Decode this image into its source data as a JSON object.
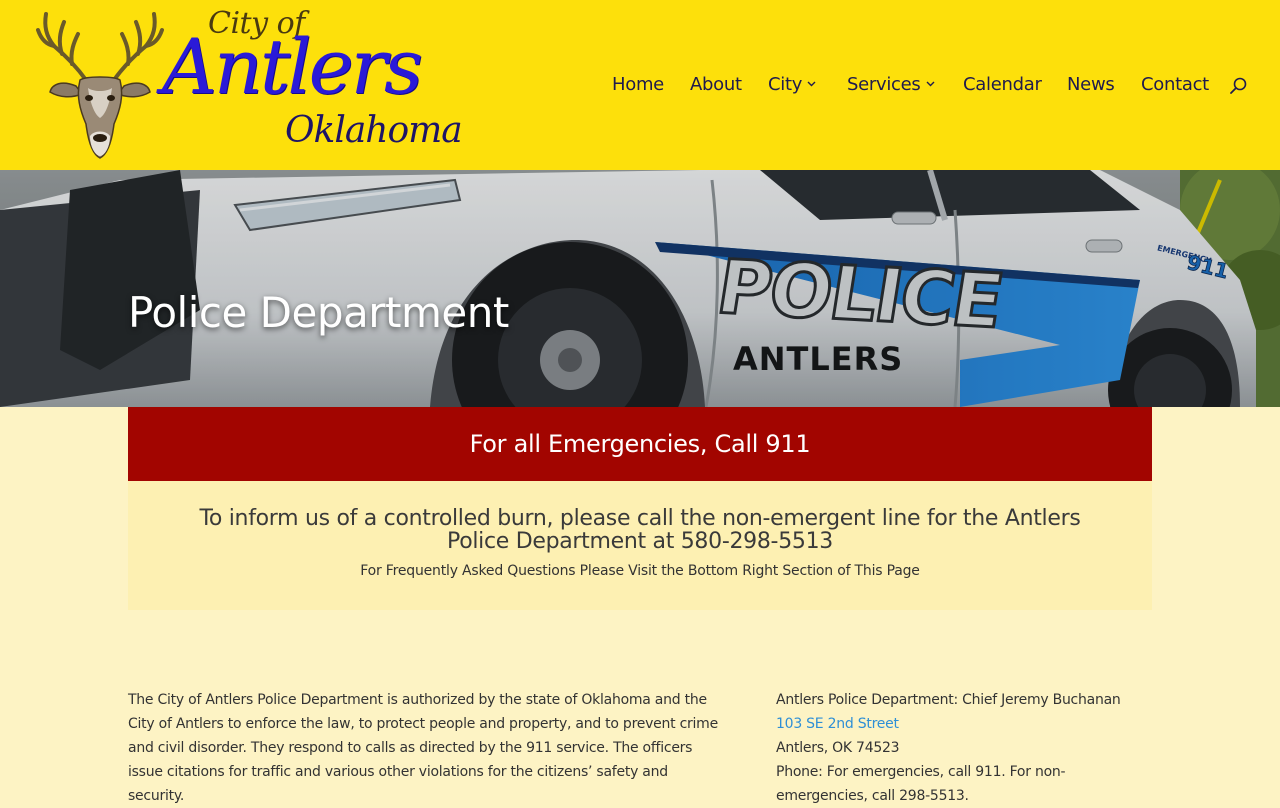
{
  "logo": {
    "city_of": "City of",
    "name": "Antlers",
    "state": "Oklahoma"
  },
  "nav": {
    "items": [
      {
        "label": "Home",
        "has_dropdown": false
      },
      {
        "label": "About",
        "has_dropdown": false
      },
      {
        "label": "City",
        "has_dropdown": true
      },
      {
        "label": "Services",
        "has_dropdown": true
      },
      {
        "label": "Calendar",
        "has_dropdown": false
      },
      {
        "label": "News",
        "has_dropdown": false
      },
      {
        "label": "Contact",
        "has_dropdown": false
      }
    ],
    "search_icon": "search-icon"
  },
  "hero": {
    "title": "Police Department",
    "car_text_police": "POLICE",
    "car_text_city": "ANTLERS",
    "car_text_emergency": "EMERGENCY",
    "car_text_911": "911"
  },
  "emergency": {
    "text": "For all Emergencies, Call 911"
  },
  "info": {
    "main": "To inform us of a controlled burn, please call the non-emergent line for the Antlers Police Department at 580-298-5513",
    "sub": "For Frequently Asked Questions Please Visit the Bottom Right Section of This Page"
  },
  "about": {
    "text": "The City of Antlers Police Department is authorized by the state of Oklahoma and the City of Antlers to enforce the law, to protect people and property, and to prevent crime and civil disorder. They respond to calls as directed by the 911 service. The officers issue citations for traffic and various other violations for the citizens’ safety and security."
  },
  "contact": {
    "dept": "Antlers Police Department: Chief Jeremy Buchanan",
    "address_link": "103 SE 2nd Street",
    "city_state": "Antlers, OK 74523",
    "phone": "Phone: For emergencies, call 911. For non-emergencies, call 298-5513."
  },
  "colors": {
    "header_bg": "#fde00b",
    "nav_text": "#1f1b4d",
    "emergency_bg": "#a20500",
    "info_bg": "#fdf0b2",
    "page_bg": "#fdf3c4",
    "link": "#2e8fd6",
    "logo_blue": "#2a1ad8"
  }
}
